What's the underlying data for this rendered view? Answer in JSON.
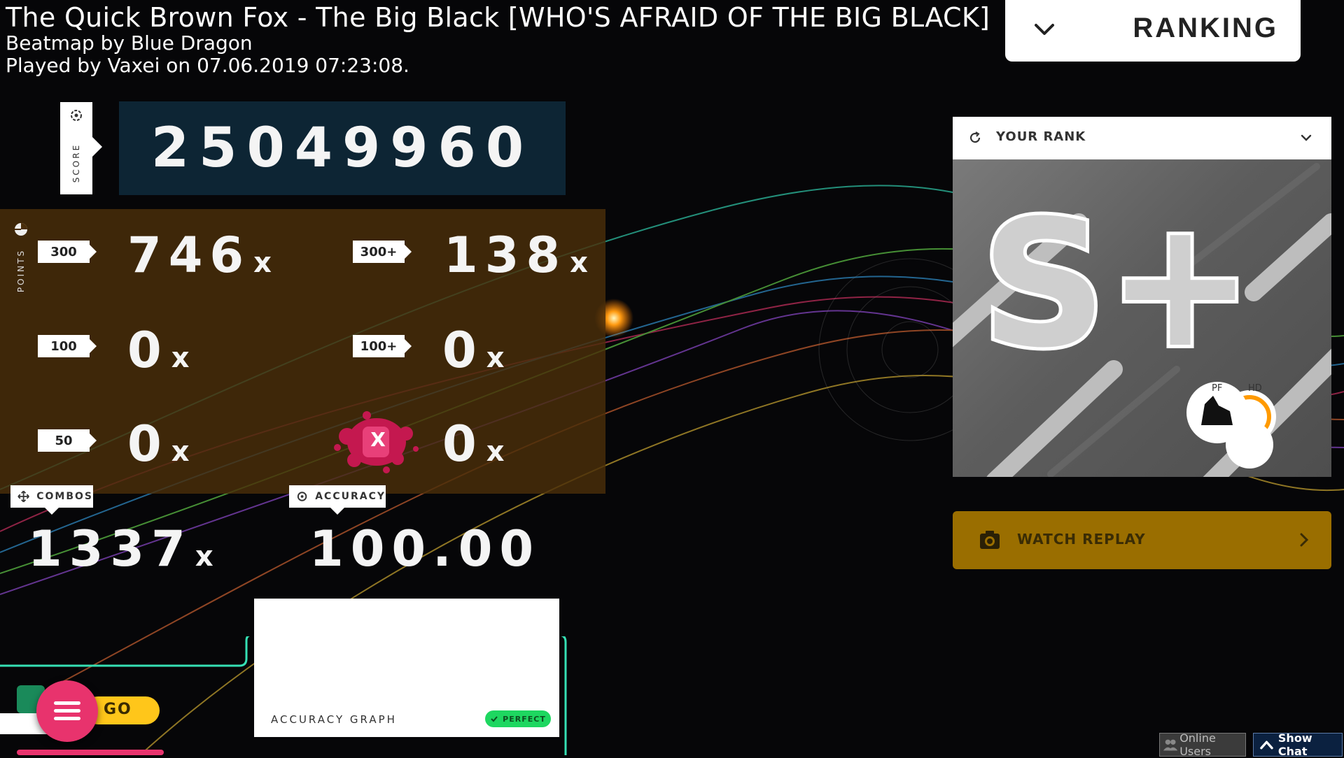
{
  "header": {
    "title": "The Quick Brown Fox - The Big Black [WHO'S AFRAID OF THE BIG BLACK]",
    "mapper": "Beatmap by Blue Dragon",
    "played": "Played by Vaxei on 07.06.2019 07:23:08."
  },
  "ranking_button": {
    "label": "RANKING",
    "icon": "chevron-down-icon"
  },
  "score": {
    "tab_label": "SCORE",
    "value": "25049960"
  },
  "points": {
    "side_label": "POINTS",
    "hits": [
      {
        "label": "300",
        "value": "746",
        "unit": "x"
      },
      {
        "label": "300+",
        "value": "138",
        "unit": "x"
      },
      {
        "label": "100",
        "value": "0",
        "unit": "x"
      },
      {
        "label": "100+",
        "value": "0",
        "unit": "x"
      },
      {
        "label": "50",
        "value": "0",
        "unit": "x"
      },
      {
        "label": "X",
        "value": "0",
        "unit": "x"
      }
    ]
  },
  "combos": {
    "label": "COMBOS",
    "value": "1337",
    "unit": "x"
  },
  "accuracy": {
    "label": "ACCURACY",
    "value": "100.00"
  },
  "rank_card": {
    "header": "YOUR RANK",
    "grade": "S+",
    "mods": [
      "PF",
      "HD"
    ]
  },
  "replay": {
    "label": "WATCH REPLAY"
  },
  "accuracy_graph": {
    "label": "ACCURACY GRAPH",
    "badge": "PERFECT"
  },
  "go_button": {
    "label": "GO"
  },
  "footer": {
    "online_users": "Online Users",
    "show_chat": "Show Chat"
  },
  "colors": {
    "accent_pink": "#e8336d",
    "go_yellow": "#ffc61a",
    "replay_gold": "#9a6e00",
    "perfect_green": "#1ed760",
    "frame_teal": "#35e0b4"
  }
}
